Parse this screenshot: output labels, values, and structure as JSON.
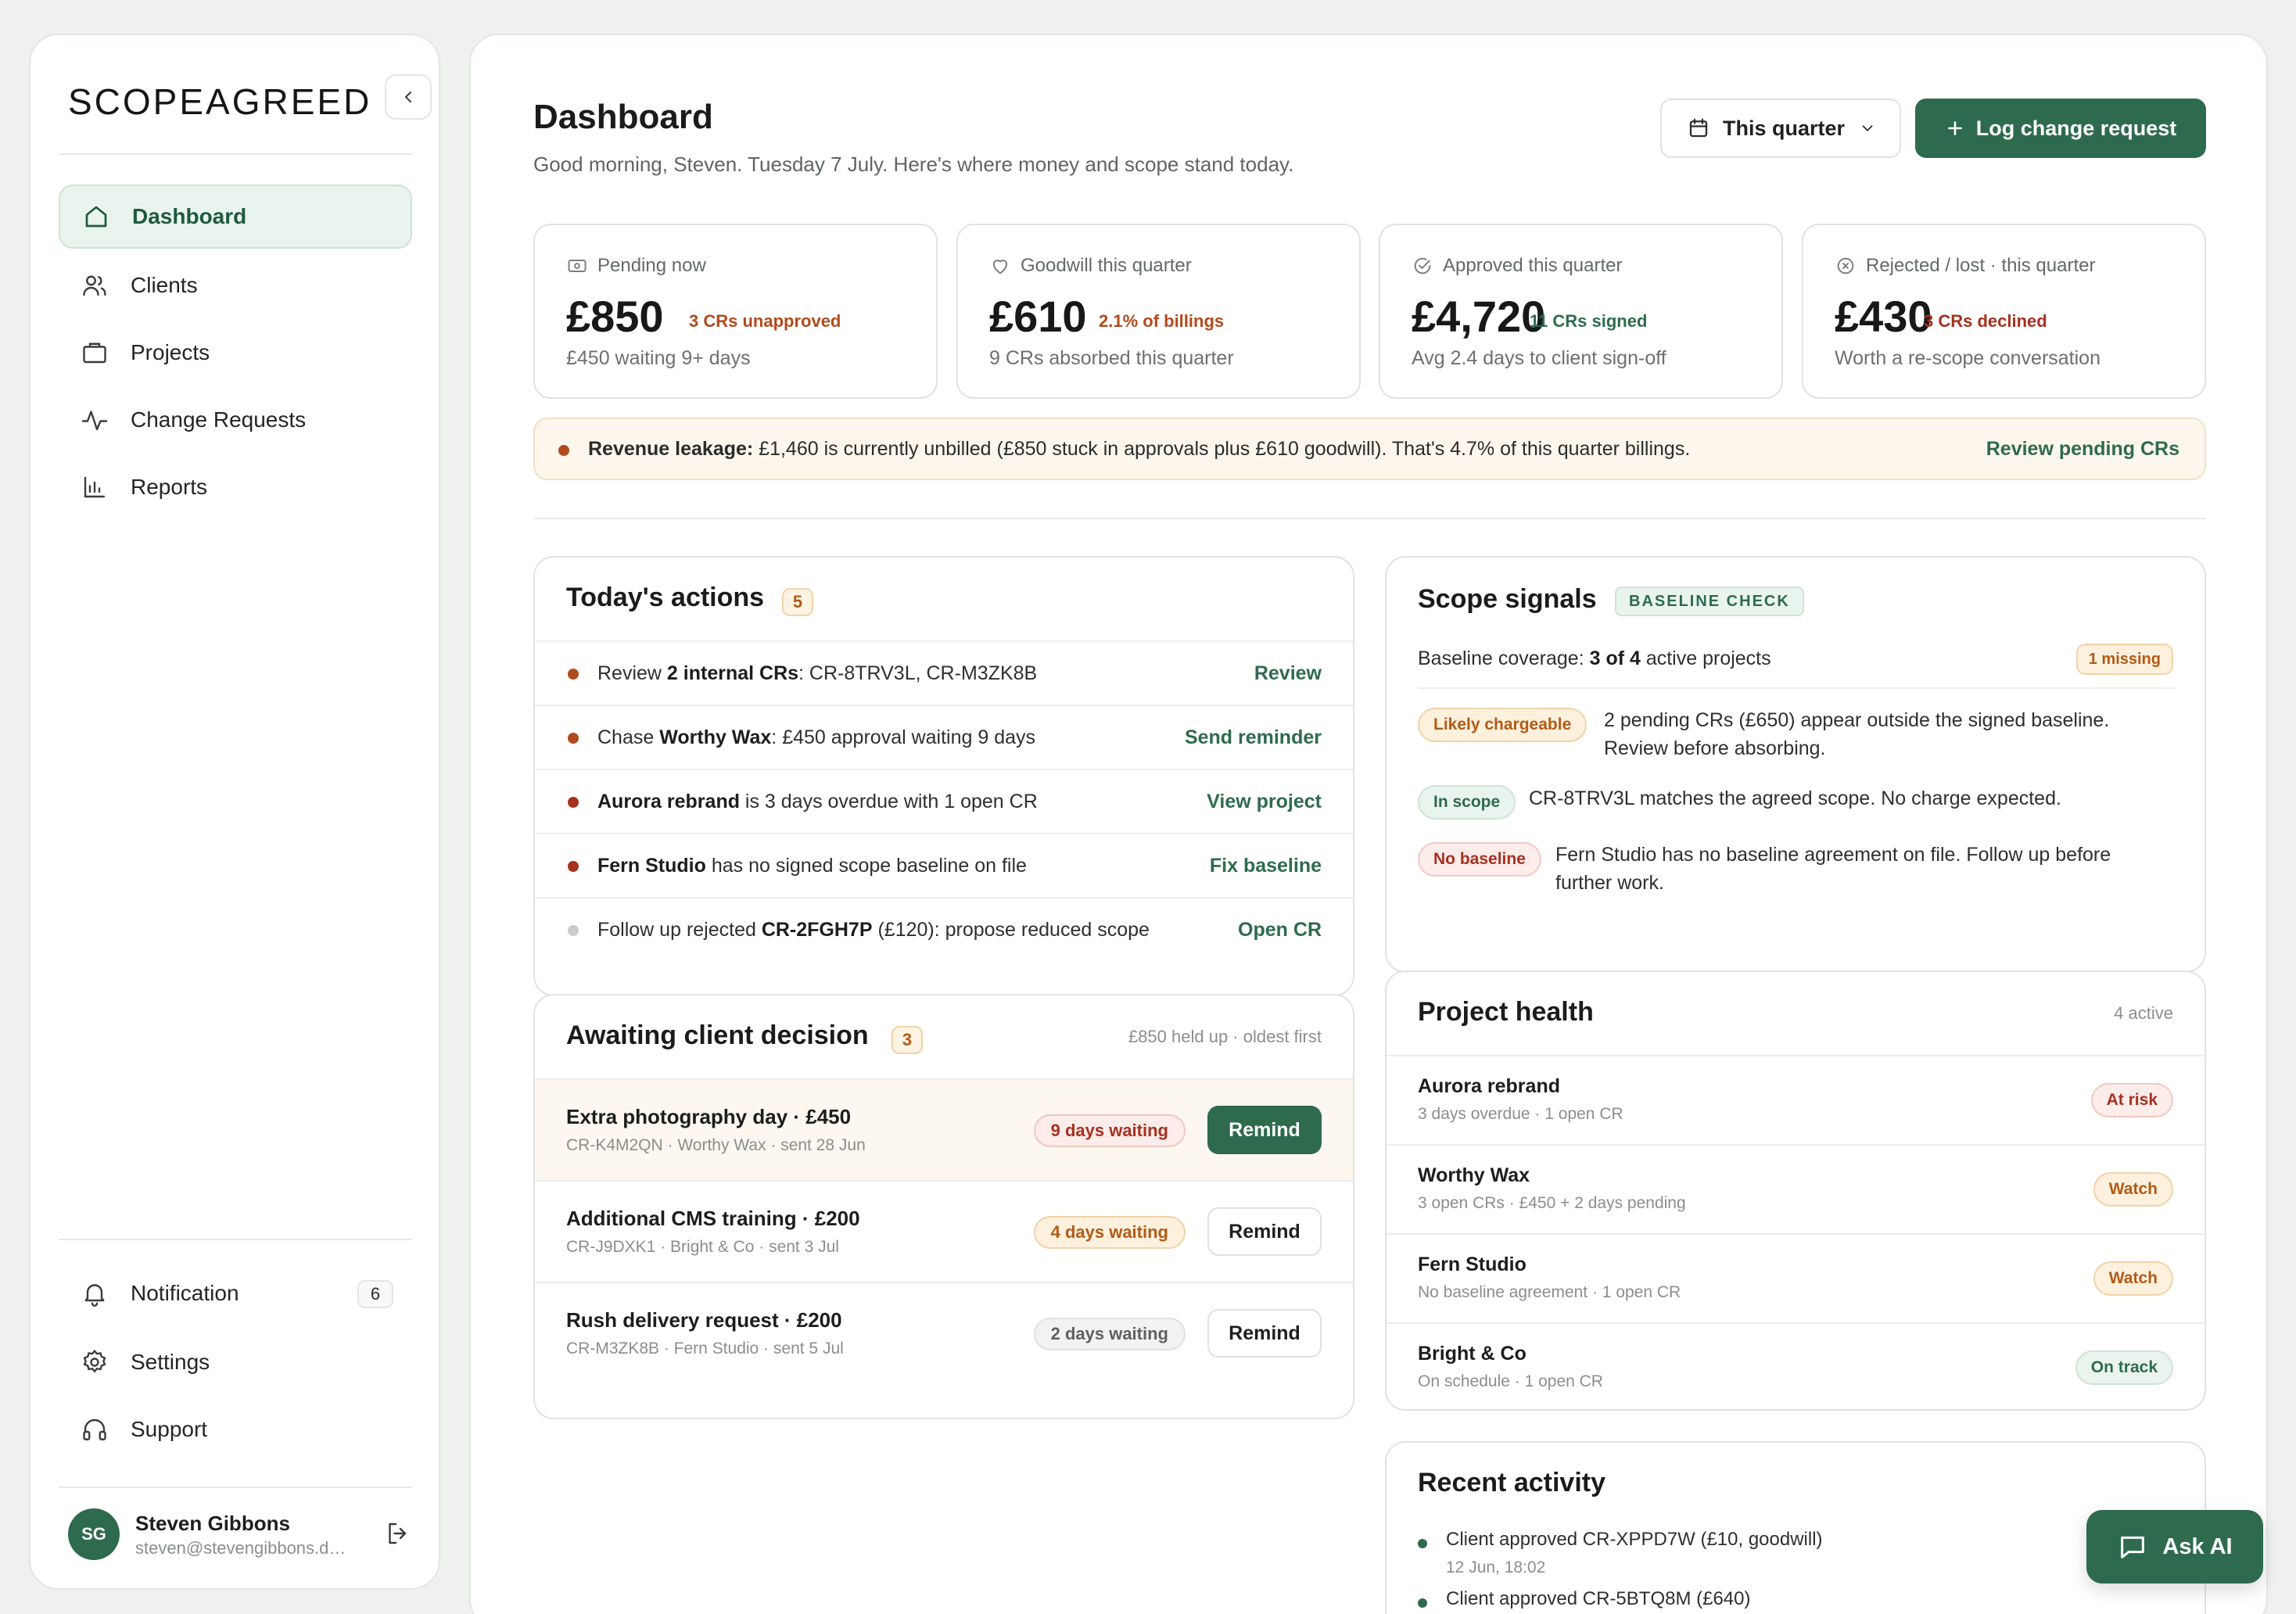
{
  "sidebar": {
    "logo": "SCOPEAGREED",
    "nav": [
      {
        "label": "Dashboard",
        "icon": "home-icon",
        "active": true
      },
      {
        "label": "Clients",
        "icon": "users-icon"
      },
      {
        "label": "Projects",
        "icon": "briefcase-icon"
      },
      {
        "label": "Change Requests",
        "icon": "activity-icon"
      },
      {
        "label": "Reports",
        "icon": "bar-chart-icon"
      }
    ],
    "bottom": [
      {
        "label": "Notification",
        "icon": "bell-icon",
        "badge": "6"
      },
      {
        "label": "Settings",
        "icon": "gear-icon"
      },
      {
        "label": "Support",
        "icon": "headphones-icon"
      }
    ],
    "user": {
      "initials": "SG",
      "name": "Steven Gibbons",
      "email": "steven@stevengibbons.design"
    }
  },
  "header": {
    "title": "Dashboard",
    "subtitle": "Good morning, Steven. Tuesday 7 July. Here's where money and scope stand today.",
    "period": "This quarter",
    "primary_action": "Log change request"
  },
  "kpis": [
    {
      "label": "Pending now",
      "icon": "banknote-icon",
      "value": "£850",
      "tag": "3 CRs unapproved",
      "tag_color": "#b24a1b",
      "foot": "£450 waiting 9+ days"
    },
    {
      "label": "Goodwill this quarter",
      "icon": "heart-icon",
      "value": "£610",
      "tag": "2.1% of billings",
      "tag_color": "#b24a1b",
      "foot": "9 CRs absorbed this quarter"
    },
    {
      "label": "Approved this quarter",
      "icon": "check-circle-icon",
      "value": "£4,720",
      "tag": "11 CRs signed",
      "tag_color": "#2e6b4e",
      "foot": "Avg 2.4 days to client sign-off"
    },
    {
      "label": "Rejected / lost · this quarter",
      "icon": "x-circle-icon",
      "value": "£430",
      "tag": "3 CRs declined",
      "tag_color": "#a8301f",
      "foot": "Worth a re-scope conversation"
    }
  ],
  "leakage": {
    "label": "Revenue leakage:",
    "text": "£1,460 is currently unbilled (£850 stuck in approvals plus £610 goodwill). That's 4.7% of this quarter billings.",
    "action": "Review pending CRs"
  },
  "todays_actions": {
    "title": "Today's actions",
    "count": "5",
    "items": [
      {
        "dot": "#b04a1c",
        "parts": [
          "Review ",
          "2 internal CRs",
          ": CR-8TRV3L, CR-M3ZK8B"
        ],
        "link": "Review"
      },
      {
        "dot": "#b04a1c",
        "parts": [
          "Chase ",
          "Worthy Wax",
          ": £450 approval waiting 9 days"
        ],
        "link": "Send reminder"
      },
      {
        "dot": "#a8301f",
        "parts": [
          "",
          "Aurora rebrand",
          " is 3 days overdue with 1 open CR"
        ],
        "link": "View project"
      },
      {
        "dot": "#a8301f",
        "parts": [
          "",
          "Fern Studio",
          " has no signed scope baseline on file"
        ],
        "link": "Fix baseline"
      },
      {
        "dot": "#c9ccca",
        "parts": [
          "Follow up rejected ",
          "CR-2FGH7P",
          " (£120): propose reduced scope"
        ],
        "link": "Open CR"
      }
    ]
  },
  "awaiting": {
    "title": "Awaiting client decision",
    "count": "3",
    "meta": "£850 held up · oldest first",
    "items": [
      {
        "title": "Extra photography day · £450",
        "sub": "CR-K4M2QN · Worthy Wax · sent 28 Jun",
        "wait": "9 days waiting",
        "tone": "red",
        "btn": "Remind",
        "primary": true
      },
      {
        "title": "Additional CMS training · £200",
        "sub": "CR-J9DXK1 · Bright & Co · sent 3 Jul",
        "wait": "4 days waiting",
        "tone": "amber",
        "btn": "Remind",
        "primary": false
      },
      {
        "title": "Rush delivery request · £200",
        "sub": "CR-M3ZK8B · Fern Studio · sent 5 Jul",
        "wait": "2 days waiting",
        "tone": "grey",
        "btn": "Remind",
        "primary": false
      }
    ]
  },
  "scope_signals": {
    "title": "Scope signals",
    "badge": "BASELINE CHECK",
    "coverage_prefix": "Baseline coverage: ",
    "coverage_bold": "3 of 4",
    "coverage_suffix": " active projects",
    "missing": "1 missing",
    "signals": [
      {
        "tag": "Likely chargeable",
        "tone": "amber",
        "lines": [
          "2 pending CRs (£650) appear outside the signed baseline.",
          "Review before absorbing."
        ]
      },
      {
        "tag": "In scope",
        "tone": "green",
        "lines": [
          "CR-8TRV3L matches the agreed scope. No charge expected."
        ]
      },
      {
        "tag": "No baseline",
        "tone": "red",
        "lines": [
          "Fern Studio has no baseline agreement on file. Follow up before",
          "further work."
        ]
      }
    ]
  },
  "project_health": {
    "title": "Project health",
    "meta": "4 active",
    "projects": [
      {
        "name": "Aurora rebrand",
        "sub": "3 days overdue · 1 open CR",
        "status": "At risk",
        "tone": "red"
      },
      {
        "name": "Worthy Wax",
        "sub": "3 open CRs · £450 + 2 days pending",
        "status": "Watch",
        "tone": "amber"
      },
      {
        "name": "Fern Studio",
        "sub": "No baseline agreement · 1 open CR",
        "status": "Watch",
        "tone": "amber"
      },
      {
        "name": "Bright & Co",
        "sub": "On schedule · 1 open CR",
        "status": "On track",
        "tone": "green"
      }
    ]
  },
  "recent_activity": {
    "title": "Recent activity",
    "items": [
      {
        "text": "Client approved CR-XPPD7W (£10, goodwill)",
        "time": "12 Jun, 18:02"
      },
      {
        "text": "Client approved CR-5BTQ8M (£640)",
        "time": ""
      }
    ]
  },
  "ask_ai": "Ask AI",
  "colors": {
    "brand": "#2e6b4e",
    "warning": "#b04a1c",
    "danger": "#a8301f"
  }
}
